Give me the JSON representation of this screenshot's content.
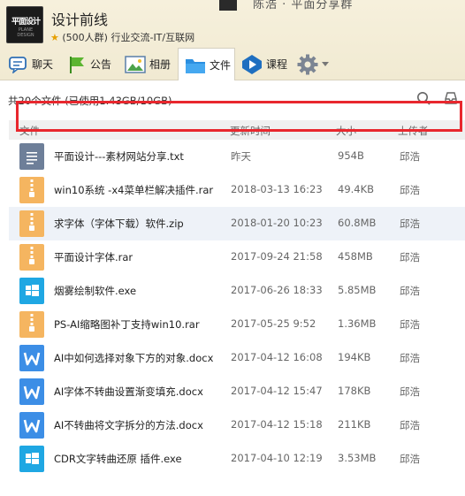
{
  "group": {
    "name": "设计前线",
    "members": "(500人群)",
    "category": "行业交流-IT/互联网",
    "logo_text": "平面设计",
    "logo_sub": "PLANE DESIGN"
  },
  "background_banner": "陈浩 · 平面分享群",
  "tabs": [
    {
      "label": "聊天",
      "icon": "chat-icon"
    },
    {
      "label": "公告",
      "icon": "announcement-flag-icon"
    },
    {
      "label": "相册",
      "icon": "photo-album-icon"
    },
    {
      "label": "文件",
      "icon": "folder-icon",
      "active": true
    },
    {
      "label": "课程",
      "icon": "course-play-icon"
    }
  ],
  "settings_icon": "gear-icon",
  "file_summary": "共20个文件 (已使用1.43GB/10GB)",
  "toolbar": {
    "search_icon": "search-icon",
    "inbox_icon": "inbox-icon"
  },
  "columns": {
    "name": "文件",
    "time": "更新时间",
    "size": "大小",
    "uploader": "上传者"
  },
  "files": [
    {
      "name": "平面设计---素材网站分享.txt",
      "time": "昨天",
      "size": "954B",
      "uploader": "邱浩",
      "type": "txt"
    },
    {
      "name": "win10系统 -x4菜单栏解决插件.rar",
      "time": "2018-03-13 16:23",
      "size": "49.4KB",
      "uploader": "邱浩",
      "type": "zip",
      "highlighted": true
    },
    {
      "name": "求字体（字体下载）软件.zip",
      "time": "2018-01-20 10:23",
      "size": "60.8MB",
      "uploader": "邱浩",
      "type": "zip"
    },
    {
      "name": "平面设计字体.rar",
      "time": "2017-09-24 21:58",
      "size": "458MB",
      "uploader": "邱浩",
      "type": "zip"
    },
    {
      "name": "烟雾绘制软件.exe",
      "time": "2017-06-26 18:33",
      "size": "5.85MB",
      "uploader": "邱浩",
      "type": "exe"
    },
    {
      "name": "PS-AI缩略图补丁支持win10.rar",
      "time": "2017-05-25 9:52",
      "size": "1.36MB",
      "uploader": "邱浩",
      "type": "zip"
    },
    {
      "name": "AI中如何选择对象下方的对象.docx",
      "time": "2017-04-12 16:08",
      "size": "194KB",
      "uploader": "邱浩",
      "type": "doc"
    },
    {
      "name": "AI字体不转曲设置渐变填充.docx",
      "time": "2017-04-12 15:47",
      "size": "178KB",
      "uploader": "邱浩",
      "type": "doc"
    },
    {
      "name": "AI不转曲将文字拆分的方法.docx",
      "time": "2017-04-12 15:18",
      "size": "211KB",
      "uploader": "邱浩",
      "type": "doc"
    },
    {
      "name": "CDR文字转曲还原 插件.exe",
      "time": "2017-04-10 12:19",
      "size": "3.53MB",
      "uploader": "邱浩",
      "type": "exe"
    }
  ],
  "colors": {
    "highlight": "#e8272e",
    "accent": "#1fa7e3"
  }
}
